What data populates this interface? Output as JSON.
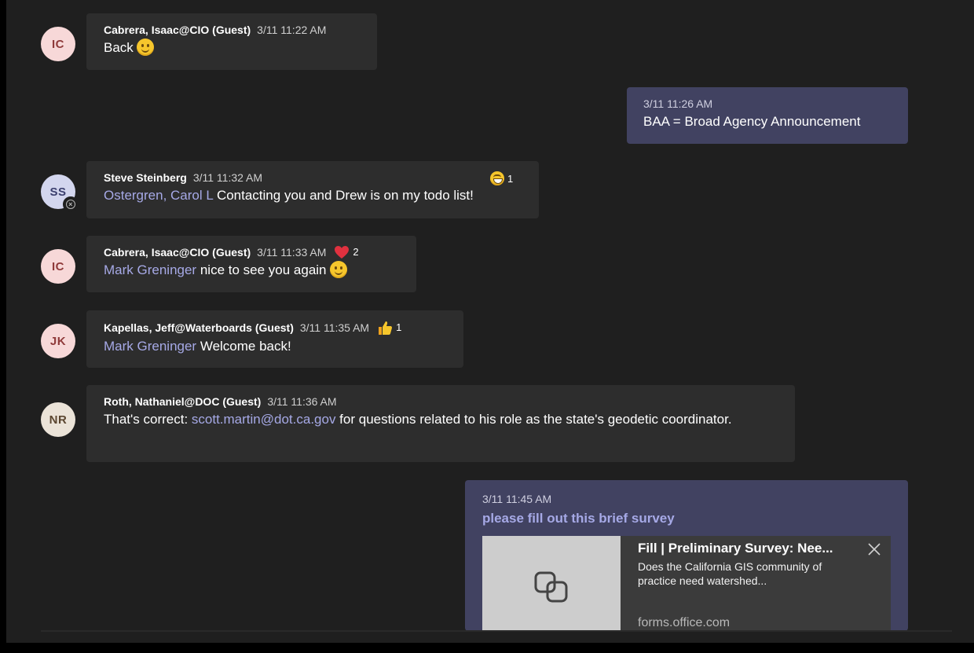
{
  "colors": {
    "background": "#1f1f1f",
    "incoming_bubble": "#2d2d2d",
    "outgoing_bubble": "#414261",
    "mention": "#a6a9e6"
  },
  "messages": [
    {
      "avatar": "IC",
      "author": "Cabrera, Isaac@CIO (Guest)",
      "time": "3/11 11:22 AM",
      "text": "Back",
      "emoji": "smile-icon"
    },
    {
      "outgoing": true,
      "time": "3/11 11:26 AM",
      "text": "BAA = Broad Agency Announcement"
    },
    {
      "avatar": "SS",
      "author": "Steve Steinberg",
      "time": "3/11 11:32 AM",
      "mention": "Ostergren, Carol L",
      "text": " Contacting you and Drew is on my todo list!",
      "reaction": {
        "icon": "laugh-icon",
        "count": "1"
      }
    },
    {
      "avatar": "IC",
      "author": "Cabrera, Isaac@CIO (Guest)",
      "time": "3/11 11:33 AM",
      "mention": "Mark Greninger",
      "text": " nice to see you again",
      "emoji": "smile-icon",
      "reaction": {
        "icon": "heart-icon",
        "count": "2"
      }
    },
    {
      "avatar": "JK",
      "author": "Kapellas, Jeff@Waterboards (Guest)",
      "time": "3/11 11:35 AM",
      "mention": "Mark Greninger",
      "text": " Welcome back!",
      "reaction": {
        "icon": "like-icon",
        "count": "1"
      }
    },
    {
      "avatar": "NR",
      "author": "Roth, Nathaniel@DOC (Guest)",
      "time": "3/11 11:36 AM",
      "text_before": "That's correct: ",
      "link": "scott.martin@dot.ca.gov",
      "text_after": " for questions related to his role as the state's geodetic coordinator."
    },
    {
      "outgoing": true,
      "time": "3/11 11:45 AM",
      "link_text": "please fill out this brief survey",
      "card": {
        "title": "Fill | Preliminary Survey: Nee...",
        "description": "Does the California GIS community of practice need watershed...",
        "domain": "forms.office.com",
        "thumb_icon": "link-icon",
        "close_icon": "close-icon"
      }
    }
  ]
}
